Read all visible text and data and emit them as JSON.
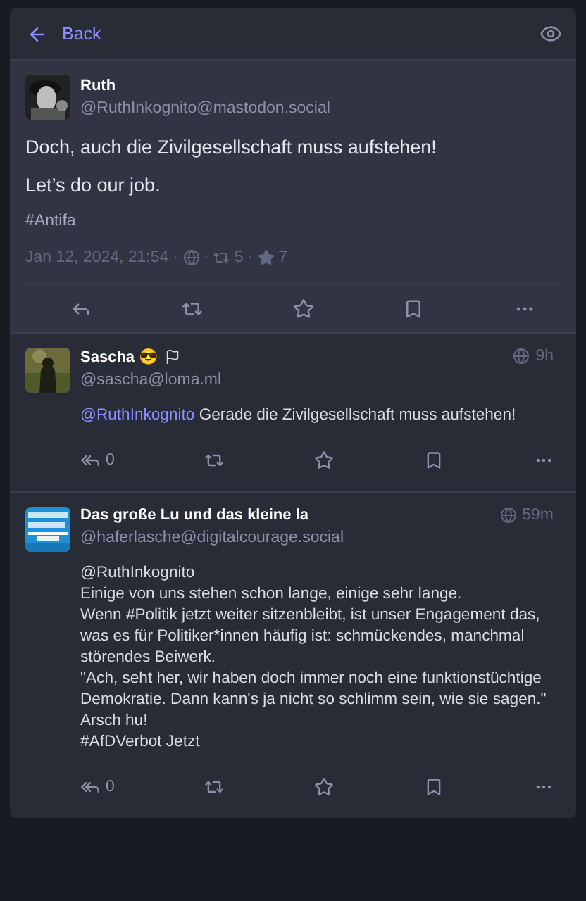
{
  "header": {
    "back_label": "Back"
  },
  "status": {
    "display_name": "Ruth",
    "handle": "@RuthInkognito@mastodon.social",
    "paragraphs": [
      "Doch, auch die Zivilgesellschaft muss aufstehen!",
      "Let’s do our job."
    ],
    "hashtag": "#Antifa",
    "meta": {
      "date": "Jan 12, 2024, 21:54",
      "separator": "·",
      "boosts": "5",
      "favourites": "7"
    }
  },
  "replies": [
    {
      "display_name": "Sascha 😎",
      "flag": true,
      "handle": "@sascha@loma.ml",
      "time": "9h",
      "lines": [
        [
          {
            "kind": "mention",
            "text": "@RuthInkognito"
          },
          {
            "kind": "text",
            "text": " Gerade die Zivilgesellschaft muss aufstehen!"
          }
        ]
      ],
      "reply_count": "0"
    },
    {
      "display_name": "Das große Lu und das kleine la",
      "flag": false,
      "handle": "@haferlasche@digitalcourage.social",
      "time": "59m",
      "lines": [
        [
          {
            "kind": "text",
            "text": "@RuthInkognito"
          }
        ],
        [
          {
            "kind": "text",
            "text": "Einige von uns stehen schon lange, einige sehr lange."
          }
        ],
        [
          {
            "kind": "text",
            "text": "Wenn #Politik jetzt weiter sitzenbleibt, ist unser Engagement das, was es für Politiker*innen häufig ist: schmückendes, manchmal störendes Beiwerk."
          }
        ],
        [
          {
            "kind": "text",
            "text": "\"Ach, seht her, wir haben doch immer noch eine funktionstüchtige Demokratie. Dann kann's ja nicht so schlimm sein, wie sie sagen.\""
          }
        ],
        [
          {
            "kind": "text",
            "text": "Arsch hu!"
          }
        ],
        [
          {
            "kind": "text",
            "text": "#AfDVerbot Jetzt"
          }
        ]
      ],
      "reply_count": "0"
    }
  ]
}
